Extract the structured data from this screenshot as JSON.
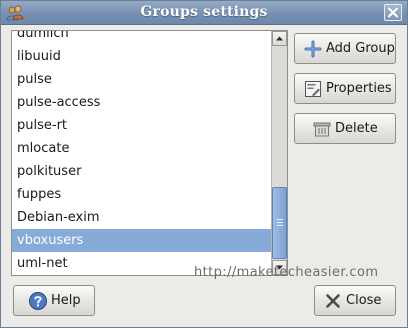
{
  "window": {
    "title": "Groups settings"
  },
  "groups": {
    "items": [
      "dumlich",
      "libuuid",
      "pulse",
      "pulse-access",
      "pulse-rt",
      "mlocate",
      "polkituser",
      "fuppes",
      "Debian-exim",
      "vboxusers",
      "uml-net"
    ],
    "selected": "vboxusers"
  },
  "actions": {
    "add_group": "Add Group",
    "properties": "Properties",
    "delete": "Delete"
  },
  "footer": {
    "help": "Help",
    "close": "Close"
  },
  "watermark": "http://maketecheasier.com",
  "colors": {
    "titlebar": "#7791b3",
    "selection": "#86abd9",
    "window_bg": "#ecebe7"
  }
}
